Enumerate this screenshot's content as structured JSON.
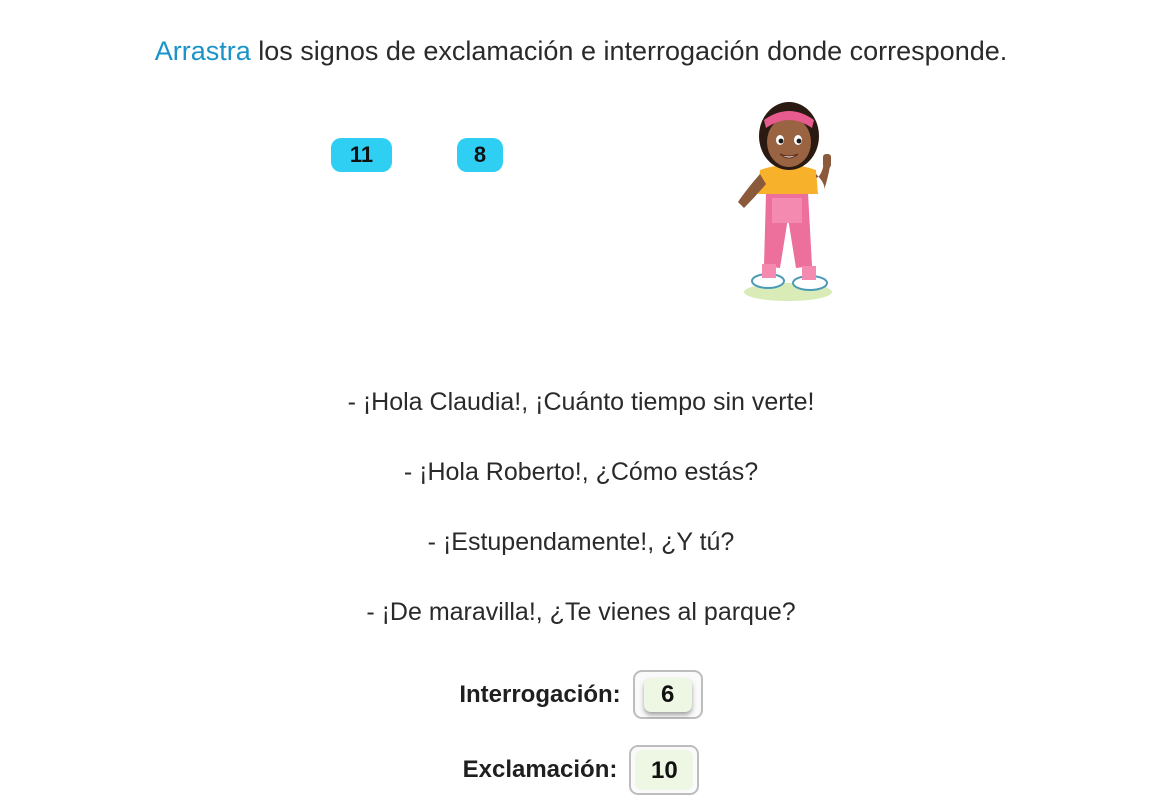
{
  "instruction": {
    "highlight": "Arrastra",
    "rest": " los signos de exclamación e interrogación donde corresponde."
  },
  "draggable_chips": [
    {
      "value": "11"
    },
    {
      "value": "8"
    }
  ],
  "character": {
    "icon": "girl-character-illustration"
  },
  "dialogue": [
    "- ¡Hola Claudia!, ¡Cuánto tiempo sin verte!",
    "- ¡Hola Roberto!, ¿Cómo estás?",
    "- ¡Estupendamente!, ¿Y tú?",
    "- ¡De maravilla!, ¿Te vienes al parque?"
  ],
  "counters": {
    "interrogacion": {
      "label": "Interrogación:",
      "value": "6"
    },
    "exclamacion": {
      "label": "Exclamación:",
      "value": "10"
    }
  },
  "colors": {
    "accent": "#1a93c9",
    "chip": "#2ecff3",
    "counter_fill": "#eef6e4"
  }
}
